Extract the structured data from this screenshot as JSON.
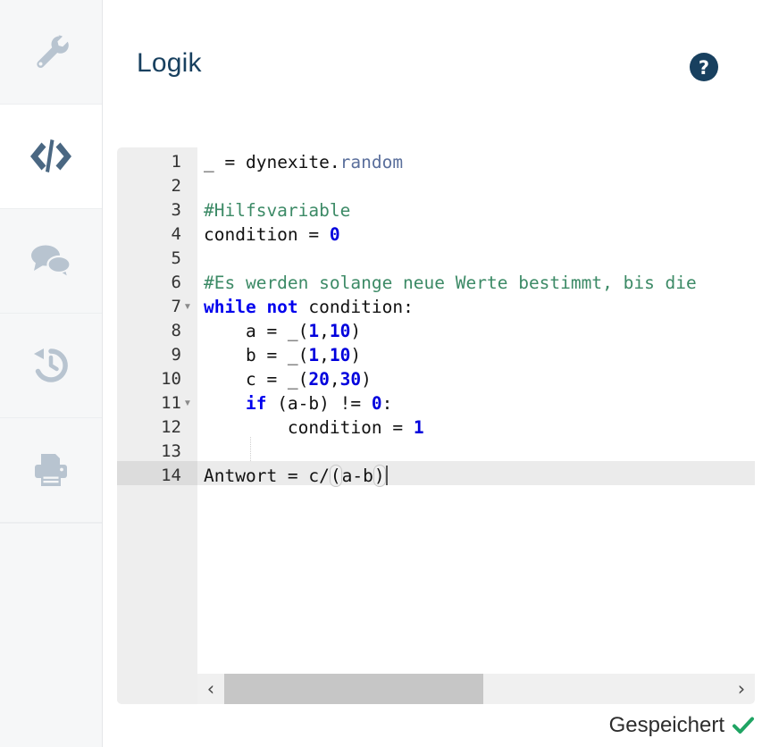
{
  "app": {
    "title": "Logik"
  },
  "sidebar": {
    "items": [
      {
        "name": "settings",
        "icon": "wrench-icon",
        "active": false
      },
      {
        "name": "code",
        "icon": "code-icon",
        "active": true
      },
      {
        "name": "comments",
        "icon": "chat-icon",
        "active": false
      },
      {
        "name": "history",
        "icon": "history-icon",
        "active": false
      },
      {
        "name": "print",
        "icon": "printer-icon",
        "active": false
      }
    ]
  },
  "header": {
    "title": "Logik",
    "help_label": "?"
  },
  "editor": {
    "language": "python",
    "active_line": 14,
    "lines": [
      {
        "num": "1",
        "fold": false,
        "text": "_ = dynexite.random"
      },
      {
        "num": "2",
        "fold": false,
        "text": ""
      },
      {
        "num": "3",
        "fold": false,
        "text": "#Hilfsvariable"
      },
      {
        "num": "4",
        "fold": false,
        "text": "condition = 0"
      },
      {
        "num": "5",
        "fold": false,
        "text": ""
      },
      {
        "num": "6",
        "fold": false,
        "text": "#Es werden solange neue Werte bestimmt, bis die"
      },
      {
        "num": "7",
        "fold": true,
        "text": "while not condition:"
      },
      {
        "num": "8",
        "fold": false,
        "text": "    a = _(1,10)"
      },
      {
        "num": "9",
        "fold": false,
        "text": "    b = _(1,10)"
      },
      {
        "num": "10",
        "fold": false,
        "text": "    c = _(20,30)"
      },
      {
        "num": "11",
        "fold": true,
        "text": "    if (a-b) != 0:"
      },
      {
        "num": "12",
        "fold": false,
        "text": "        condition = 1"
      },
      {
        "num": "13",
        "fold": false,
        "text": ""
      },
      {
        "num": "14",
        "fold": false,
        "text": "Antwort = c/(a-b)"
      }
    ],
    "scrollbar": {
      "left_arrow": "‹",
      "right_arrow": "›"
    }
  },
  "status": {
    "text": "Gespeichert",
    "icon": "check-icon",
    "check_color": "#1fa463"
  },
  "colors": {
    "brand_navy": "#18405f",
    "sidebar_bg": "#f6f7f8",
    "sidebar_icon": "#b8c4d0",
    "sidebar_icon_active": "#4a6782",
    "gutter_bg": "#eeeeee",
    "active_line_bg": "#ebebeb",
    "keyword": "#0000ee",
    "number": "#0000dd",
    "comment": "#3c8a66",
    "attribute": "#5a6f9c",
    "scroll_thumb": "#c6c6c6"
  }
}
